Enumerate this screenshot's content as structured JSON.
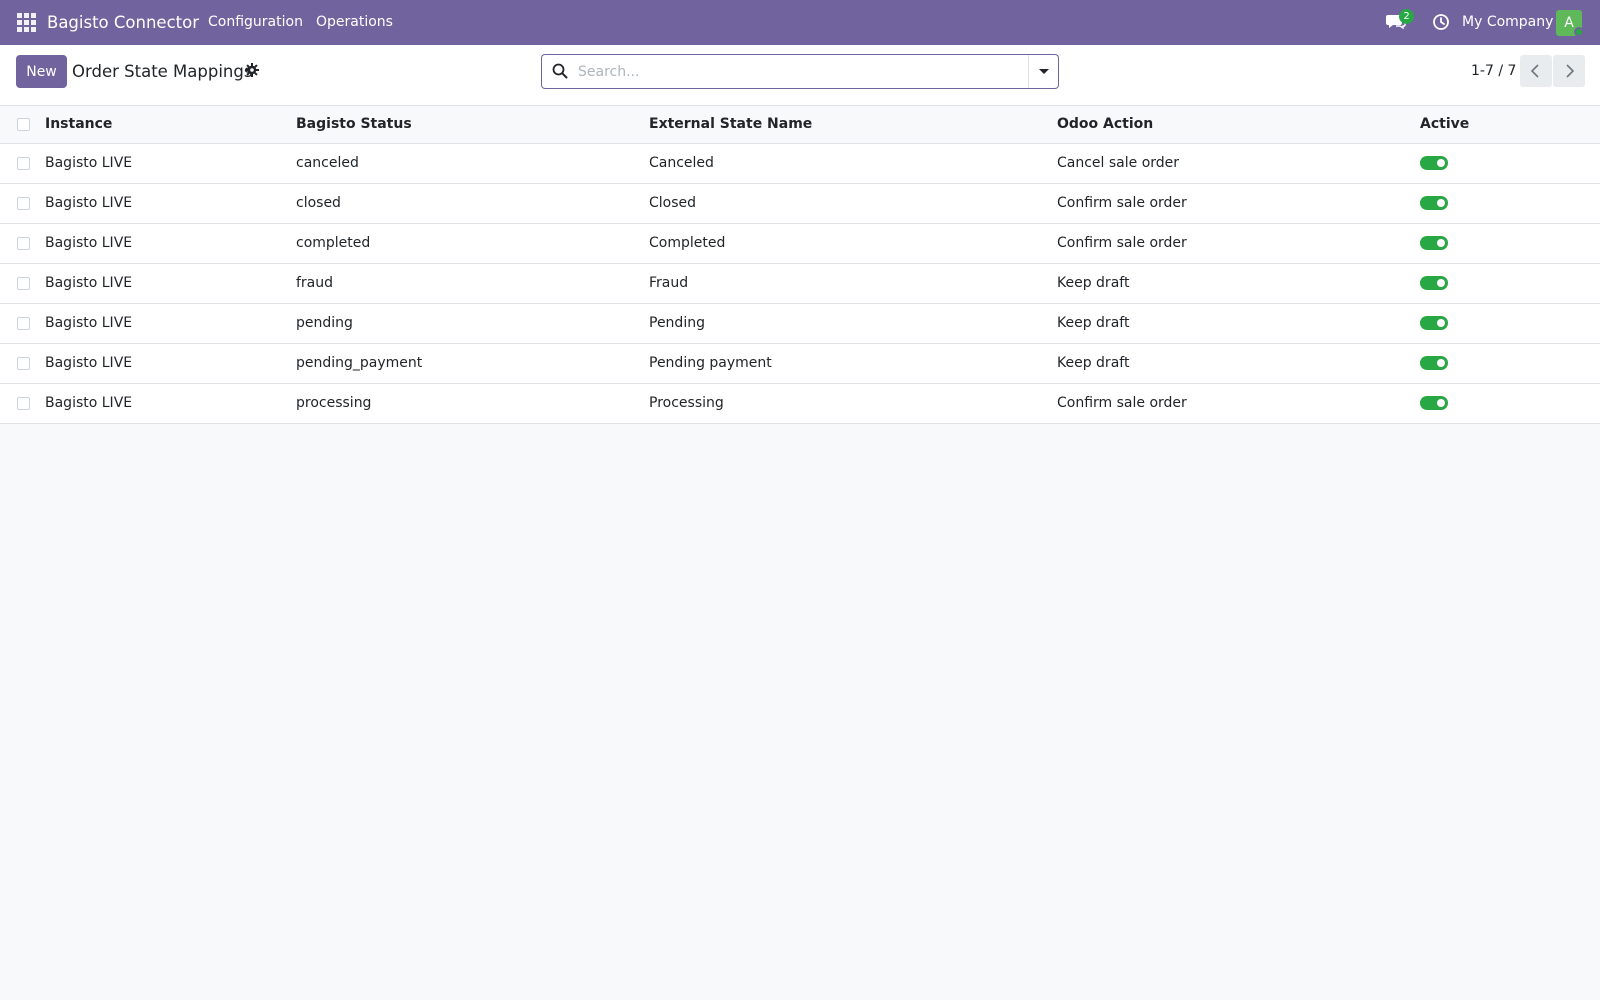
{
  "navbar": {
    "brand": "Bagisto Connector",
    "menu": [
      "Configuration",
      "Operations"
    ],
    "chat_count": "2",
    "company": "My Company",
    "avatar_initial": "A"
  },
  "control_panel": {
    "new_label": "New",
    "title": "Order State Mappings",
    "search_placeholder": "Search...",
    "pager": "1-7 / 7"
  },
  "table": {
    "columns": [
      "Instance",
      "Bagisto Status",
      "External State Name",
      "Odoo Action",
      "Active"
    ],
    "rows": [
      {
        "instance": "Bagisto LIVE",
        "status": "canceled",
        "external": "Canceled",
        "action": "Cancel sale order",
        "active": true
      },
      {
        "instance": "Bagisto LIVE",
        "status": "closed",
        "external": "Closed",
        "action": "Confirm sale order",
        "active": true
      },
      {
        "instance": "Bagisto LIVE",
        "status": "completed",
        "external": "Completed",
        "action": "Confirm sale order",
        "active": true
      },
      {
        "instance": "Bagisto LIVE",
        "status": "fraud",
        "external": "Fraud",
        "action": "Keep draft",
        "active": true
      },
      {
        "instance": "Bagisto LIVE",
        "status": "pending",
        "external": "Pending",
        "action": "Keep draft",
        "active": true
      },
      {
        "instance": "Bagisto LIVE",
        "status": "pending_payment",
        "external": "Pending payment",
        "action": "Keep draft",
        "active": true
      },
      {
        "instance": "Bagisto LIVE",
        "status": "processing",
        "external": "Processing",
        "action": "Confirm sale order",
        "active": true
      }
    ]
  },
  "colors": {
    "navbar": "#71639e",
    "primary": "#71639e",
    "toggle_on": "#28a745",
    "avatar": "#5fb85a"
  },
  "icons": {
    "apps": "apps-grid-icon",
    "chat": "chat-icon",
    "activity": "clock-icon",
    "gear": "gear-icon",
    "search": "search-icon",
    "caret": "caret-down-icon",
    "prev": "chevron-left-icon",
    "next": "chevron-right-icon"
  }
}
